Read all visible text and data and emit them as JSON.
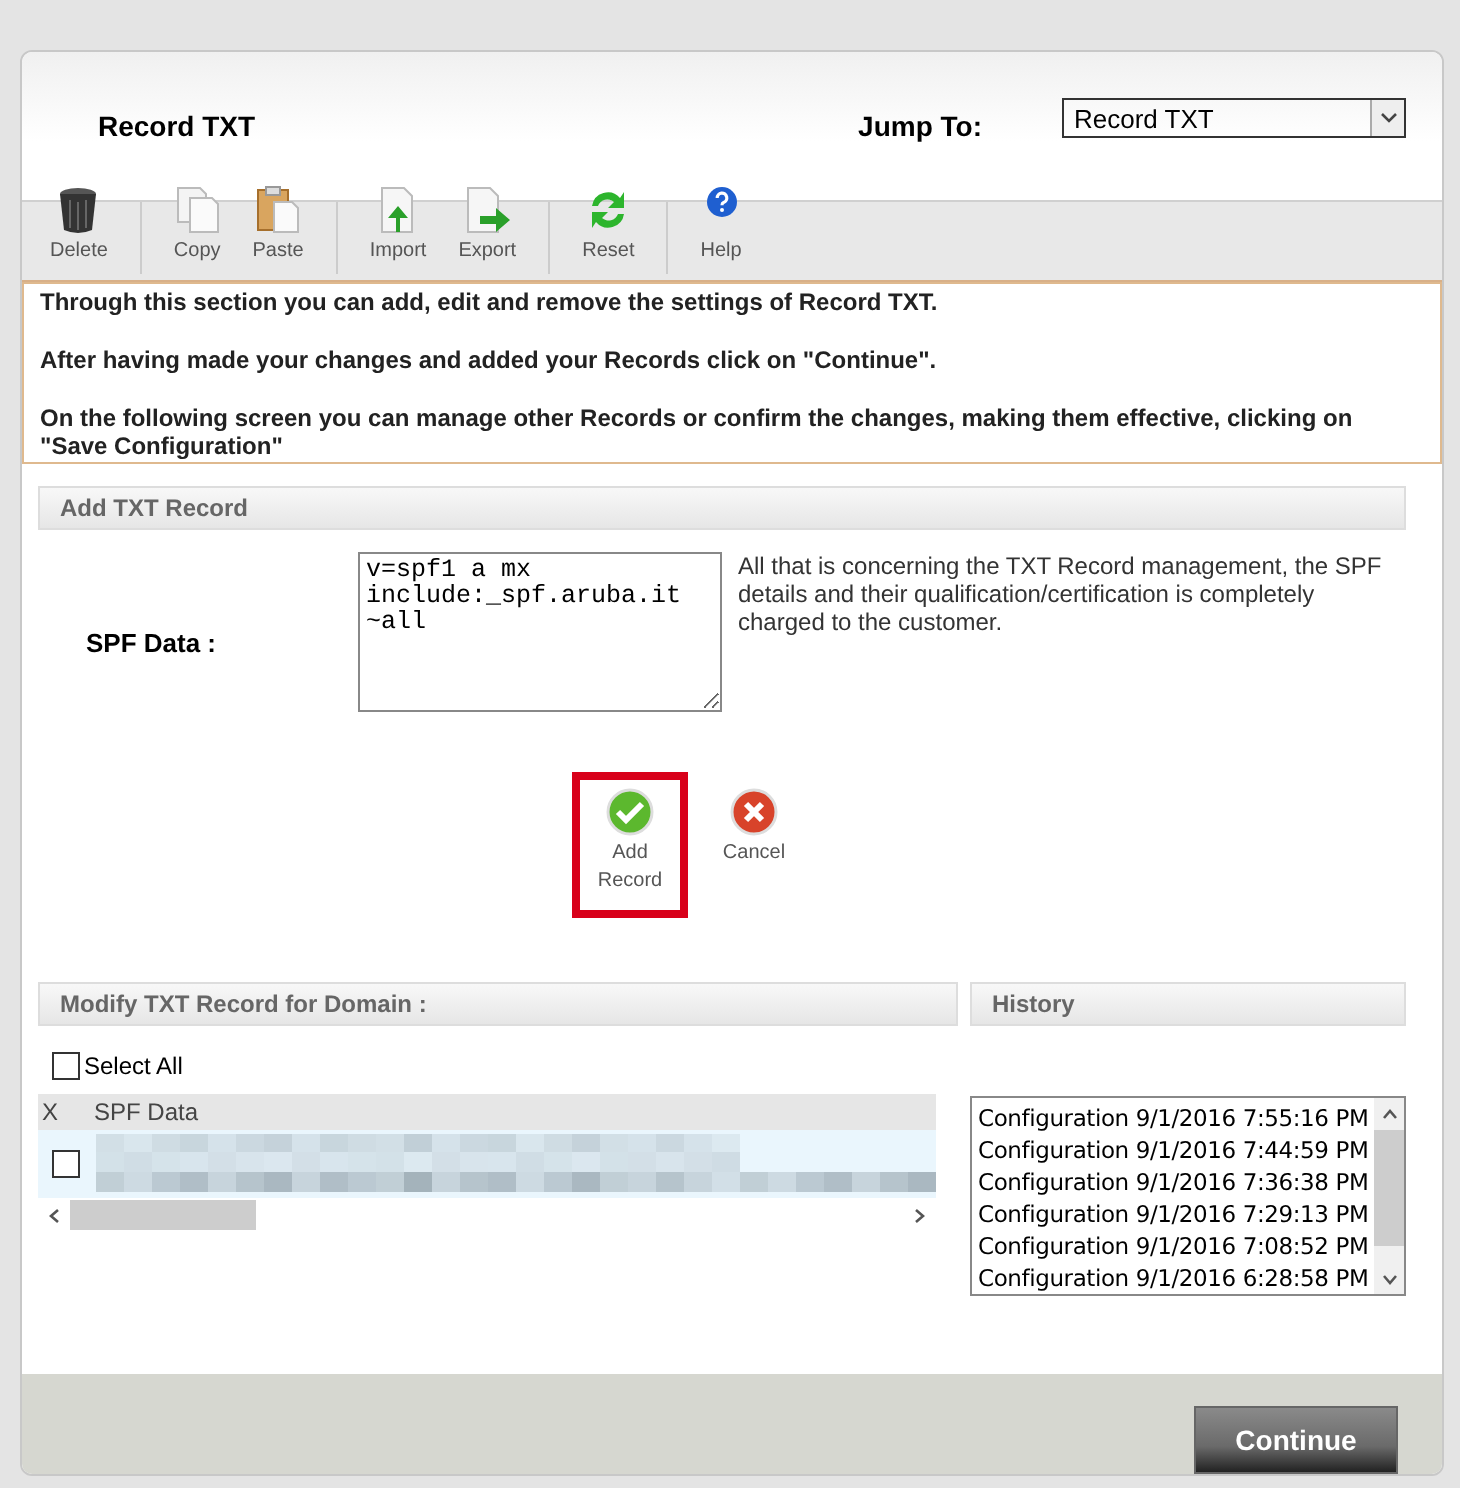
{
  "header": {
    "title": "Record TXT",
    "jump_label": "Jump To:",
    "jump_value": "Record TXT"
  },
  "toolbar": [
    {
      "items": [
        {
          "label": "Delete",
          "kind": "trash"
        }
      ]
    },
    {
      "items": [
        {
          "label": "Copy",
          "kind": "copy"
        },
        {
          "label": "Paste",
          "kind": "paste"
        }
      ]
    },
    {
      "items": [
        {
          "label": "Import",
          "kind": "import"
        },
        {
          "label": "Export",
          "kind": "export"
        }
      ]
    },
    {
      "items": [
        {
          "label": "Reset",
          "kind": "reset"
        }
      ]
    },
    {
      "items": [
        {
          "label": "Help",
          "kind": "help"
        }
      ]
    }
  ],
  "info": [
    "Through this section you can add, edit and remove the settings of Record TXT.",
    "After having made your changes and added your Records click on \"Continue\".",
    "On the following screen you can manage other Records or confirm the changes, making them effective, clicking on \"Save Configuration\""
  ],
  "add_section": {
    "title": "Add TXT Record",
    "field_label": "SPF Data :",
    "field_value": "v=spf1 a mx include:_spf.aruba.it ~all",
    "note": "All that is concerning the TXT Record management, the SPF details and their qualification/certification is completely charged to the customer."
  },
  "actions": [
    {
      "label": "Add Record",
      "kind": "ok",
      "highlighted": true
    },
    {
      "label": "Cancel",
      "kind": "cancel",
      "highlighted": false
    }
  ],
  "modify_section": {
    "title": "Modify TXT Record for Domain :",
    "select_all": {
      "label": "Select All",
      "checked": false
    },
    "columns": [
      "X",
      "SPF Data"
    ],
    "rows": [
      {
        "checked": false
      }
    ]
  },
  "history": {
    "title": "History",
    "items": [
      "Configuration 9/1/2016 7:55:16 PM",
      "Configuration 9/1/2016 7:44:59 PM",
      "Configuration 9/1/2016 7:36:38 PM",
      "Configuration 9/1/2016 7:29:13 PM",
      "Configuration 9/1/2016 7:08:52 PM",
      "Configuration 9/1/2016 6:28:58 PM"
    ]
  },
  "footer": {
    "button": "Continue"
  }
}
